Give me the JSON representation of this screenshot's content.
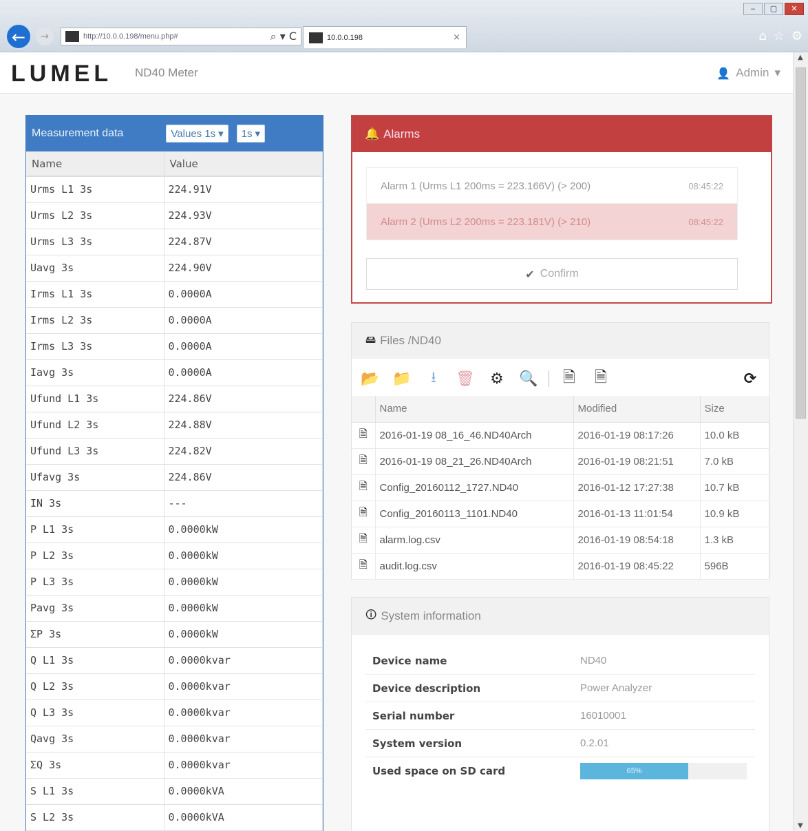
{
  "browser": {
    "address": "http://10.0.0.198/menu.php#",
    "address_tools": "⌕ ▾ C",
    "tab_title": "10.0.0.198",
    "tab_close": "×",
    "win_min": "‒",
    "win_max": "▢",
    "win_close": "✕",
    "icons": [
      "home-icon",
      "star-icon",
      "gear-icon"
    ]
  },
  "navbar": {
    "logo": "LUMEL",
    "title": "ND40 Meter",
    "user": "Admin"
  },
  "measurement": {
    "title": "Measurement data",
    "values_dropdown": "Values 1s",
    "interval_dropdown": "1s",
    "columns": [
      "Name",
      "Value"
    ],
    "rows": [
      [
        "Urms L1 3s",
        "224.91V"
      ],
      [
        "Urms L2 3s",
        "224.93V"
      ],
      [
        "Urms L3 3s",
        "224.87V"
      ],
      [
        "Uavg 3s",
        "224.90V"
      ],
      [
        "Irms L1 3s",
        "0.0000A"
      ],
      [
        "Irms L2 3s",
        "0.0000A"
      ],
      [
        "Irms L3 3s",
        "0.0000A"
      ],
      [
        "Iavg 3s",
        "0.0000A"
      ],
      [
        "Ufund L1 3s",
        "224.86V"
      ],
      [
        "Ufund L2 3s",
        "224.88V"
      ],
      [
        "Ufund L3 3s",
        "224.82V"
      ],
      [
        "Ufavg 3s",
        "224.86V"
      ],
      [
        "IN 3s",
        "---"
      ],
      [
        "P L1 3s",
        "0.0000kW"
      ],
      [
        "P L2 3s",
        "0.0000kW"
      ],
      [
        "P L3 3s",
        "0.0000kW"
      ],
      [
        "Pavg 3s",
        "0.0000kW"
      ],
      [
        "ΣP 3s",
        "0.0000kW"
      ],
      [
        "Q L1 3s",
        "0.0000kvar"
      ],
      [
        "Q L2 3s",
        "0.0000kvar"
      ],
      [
        "Q L3 3s",
        "0.0000kvar"
      ],
      [
        "Qavg 3s",
        "0.0000kvar"
      ],
      [
        "ΣQ 3s",
        "0.0000kvar"
      ],
      [
        "S L1 3s",
        "0.0000kVA"
      ],
      [
        "S L2 3s",
        "0.0000kVA"
      ]
    ]
  },
  "alarms": {
    "title": "Alarms",
    "items": [
      {
        "text": "Alarm 1 (Urms L1 200ms = 223.166V) (> 200)",
        "time": "08:45:22"
      },
      {
        "text": "Alarm 2 (Urms L2 200ms = 223.181V) (> 210)",
        "time": "08:45:22"
      }
    ],
    "confirm_label": "Confirm"
  },
  "files": {
    "title": "Files /ND40",
    "columns": [
      "Name",
      "Modified",
      "Size"
    ],
    "rows": [
      {
        "name": "2016-01-19 08_16_46.ND40Arch",
        "modified": "2016-01-19 08:17:26",
        "size": "10.0 kB"
      },
      {
        "name": "2016-01-19 08_21_26.ND40Arch",
        "modified": "2016-01-19 08:21:51",
        "size": "7.0 kB"
      },
      {
        "name": "Config_20160112_1727.ND40",
        "modified": "2016-01-12 17:27:38",
        "size": "10.7 kB"
      },
      {
        "name": "Config_20160113_1101.ND40",
        "modified": "2016-01-13 11:01:54",
        "size": "10.9 kB"
      },
      {
        "name": "alarm.log.csv",
        "modified": "2016-01-19 08:54:18",
        "size": "1.3 kB"
      },
      {
        "name": "audit.log.csv",
        "modified": "2016-01-19 08:45:22",
        "size": "596B"
      }
    ]
  },
  "system": {
    "title": "System information",
    "rows": [
      {
        "key": "Device name",
        "value": "ND40"
      },
      {
        "key": "Device description",
        "value": "Power Analyzer"
      },
      {
        "key": "Serial number",
        "value": "16010001"
      },
      {
        "key": "System version",
        "value": "0.2.01"
      }
    ],
    "sd_label": "Used space on SD card",
    "sd_used_percent": 65,
    "sd_used_text": "65%"
  },
  "colors": {
    "primary": "#3f7cc4",
    "danger": "#c24040",
    "progress": "#5bb5dd"
  }
}
